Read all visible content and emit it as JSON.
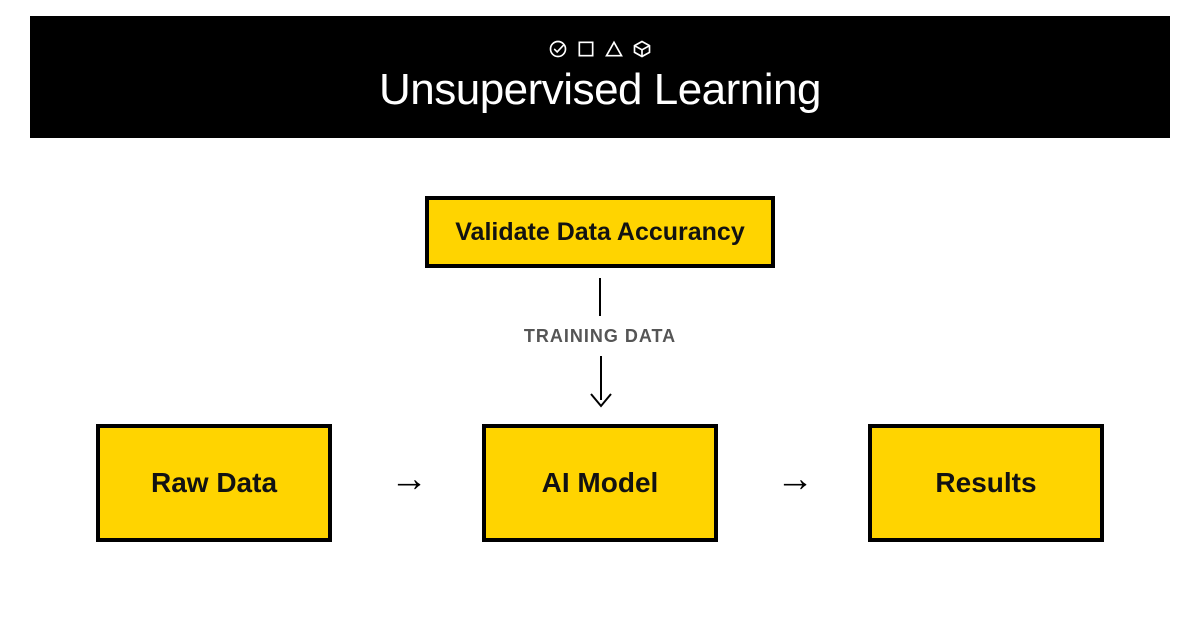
{
  "header": {
    "title": "Unsupervised Learning"
  },
  "diagram": {
    "training_label": "TRAINING DATA",
    "boxes": {
      "validate": "Validate Data Accurancy",
      "raw": "Raw Data",
      "ai": "AI Model",
      "results": "Results"
    },
    "arrows": {
      "right": "→"
    }
  }
}
